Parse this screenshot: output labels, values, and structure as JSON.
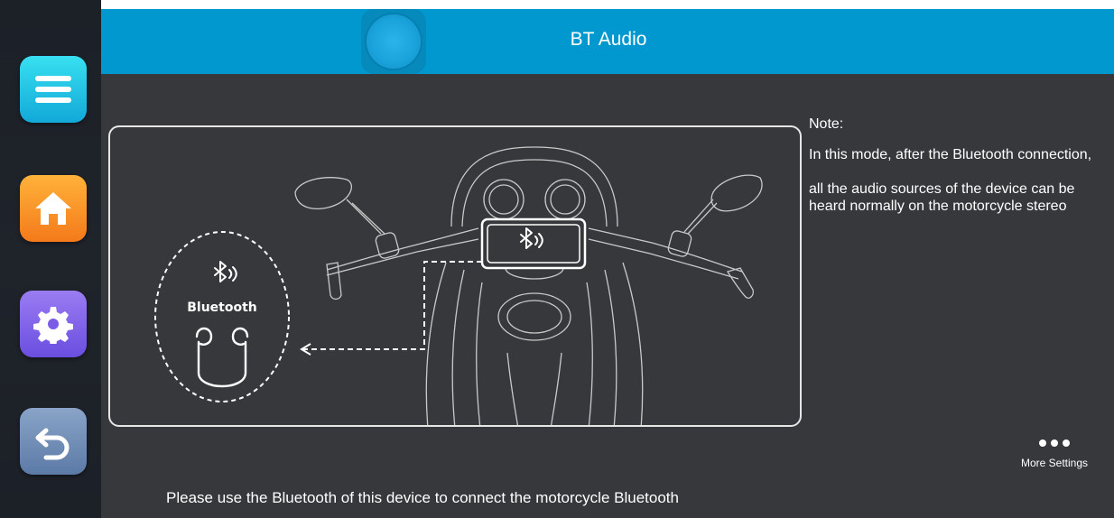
{
  "header": {
    "title": "BT Audio"
  },
  "sidebar": {
    "items": [
      {
        "name": "menu",
        "icon": "menu-icon",
        "color": "#20bde6"
      },
      {
        "name": "home",
        "icon": "home-icon",
        "color": "#f7931e"
      },
      {
        "name": "settings",
        "icon": "gear-icon",
        "color": "#7f5fe8"
      },
      {
        "name": "back",
        "icon": "back-arrow-icon",
        "color": "#6f8cb6"
      }
    ]
  },
  "illustration": {
    "bluetooth_label": "Bluetooth"
  },
  "note": {
    "title": "Note:",
    "line1": "In this mode, after the Bluetooth connection,",
    "line2": "all the audio sources of the device can be heard normally on the motorcycle stereo"
  },
  "more_settings": {
    "label": "More Settings"
  },
  "hint": "Please use the Bluetooth of this device to connect the motorcycle Bluetooth",
  "colors": {
    "header": "#0198cf",
    "background": "#36383c",
    "sidebar": "#1e2228"
  }
}
